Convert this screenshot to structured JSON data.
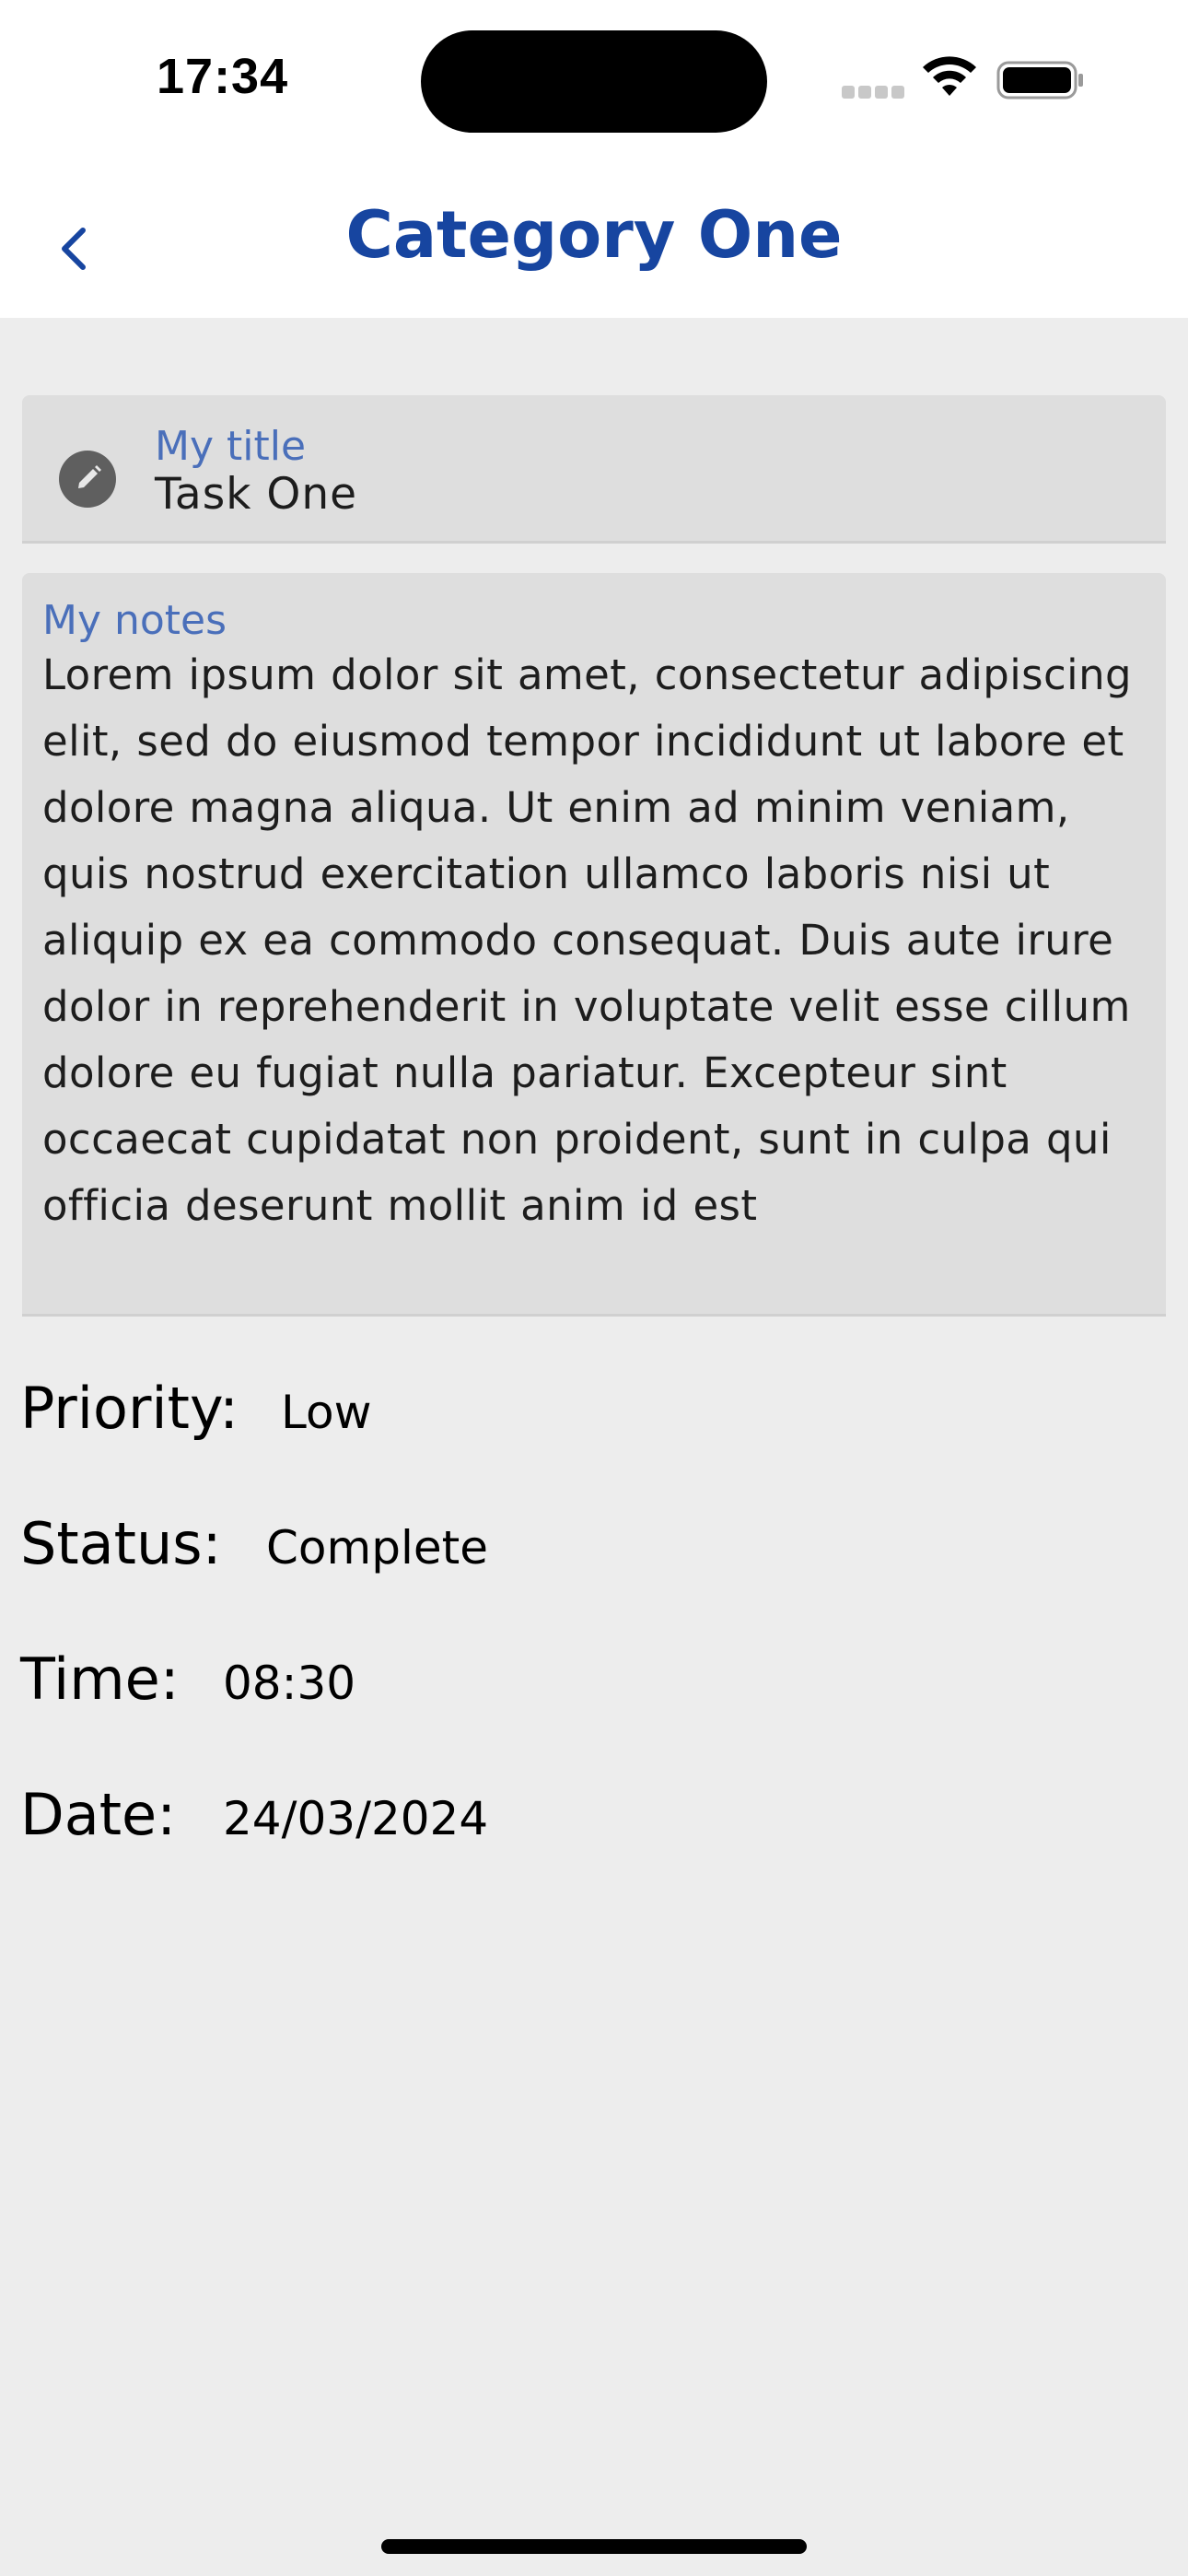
{
  "status_bar": {
    "time": "17:34"
  },
  "nav": {
    "title": "Category One",
    "back_icon": "chevron-left-icon"
  },
  "task": {
    "title_label": "My title",
    "title_value": "Task One",
    "edit_icon": "pencil-icon",
    "notes_label": "My notes",
    "notes_value": "Lorem ipsum dolor sit amet, consectetur adipiscing elit, sed do eiusmod tempor incididunt ut labore et dolore magna aliqua. Ut enim ad minim veniam, quis nostrud exercitation ullamco laboris nisi ut aliquip ex ea commodo consequat. Duis aute irure dolor in reprehenderit in voluptate velit esse cillum dolore eu fugiat nulla pariatur. Excepteur sint occaecat cupidatat non proident, sunt in culpa qui officia deserunt mollit anim id est"
  },
  "details": {
    "priority_label": "Priority:",
    "priority_value": "Low",
    "status_label": "Status:",
    "status_value": "Complete",
    "time_label": "Time:",
    "time_value": "08:30",
    "date_label": "Date:",
    "date_value": "24/03/2024"
  },
  "colors": {
    "accent": "#1745a0",
    "label": "#4a6fba",
    "background": "#ededed",
    "card": "#dedede"
  }
}
